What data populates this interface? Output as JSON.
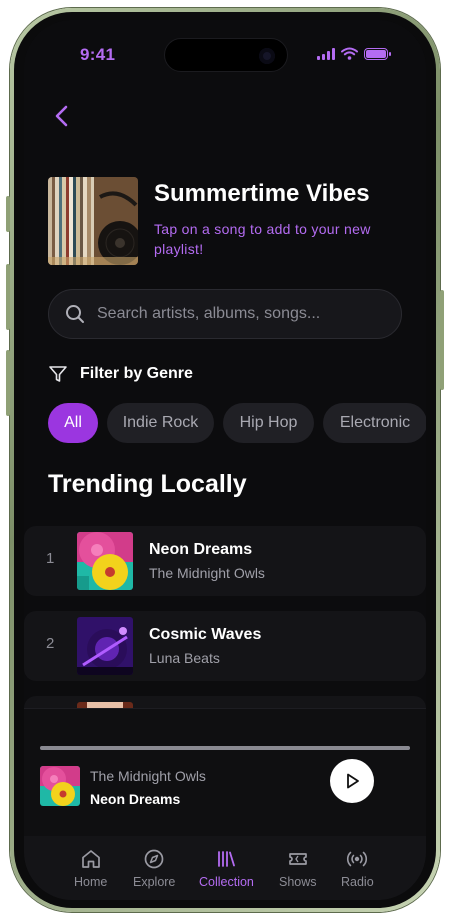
{
  "status_bar": {
    "time": "9:41"
  },
  "header": {
    "back_icon": "chevron-left-icon"
  },
  "playlist": {
    "title": "Summertime Vibes",
    "subtitle": "Tap on a song to add to your new playlist!"
  },
  "search": {
    "placeholder": "Search artists, albums, songs..."
  },
  "filter": {
    "label": "Filter by Genre",
    "icon": "filter-icon"
  },
  "genres": [
    {
      "label": "All",
      "active": true
    },
    {
      "label": "Indie Rock",
      "active": false
    },
    {
      "label": "Hip Hop",
      "active": false
    },
    {
      "label": "Electronic",
      "active": false
    }
  ],
  "section": {
    "title": "Trending Locally"
  },
  "tracks": [
    {
      "number": "1",
      "title": "Neon Dreams",
      "artist": "The Midnight Owls"
    },
    {
      "number": "2",
      "title": "Cosmic Waves",
      "artist": "Luna Beats"
    }
  ],
  "now_playing": {
    "artist": "The Midnight Owls",
    "title": "Neon Dreams",
    "progress": 1.0,
    "play_icon": "play-icon"
  },
  "tabs": [
    {
      "label": "Home",
      "icon": "home-icon",
      "active": false
    },
    {
      "label": "Explore",
      "icon": "compass-icon",
      "active": false
    },
    {
      "label": "Collection",
      "icon": "library-icon",
      "active": true
    },
    {
      "label": "Shows",
      "icon": "ticket-icon",
      "active": false
    },
    {
      "label": "Radio",
      "icon": "radio-icon",
      "active": false
    }
  ],
  "colors": {
    "accent": "#b46cf2",
    "chip_active": "#9b36e0",
    "background": "#0c0c0e"
  }
}
